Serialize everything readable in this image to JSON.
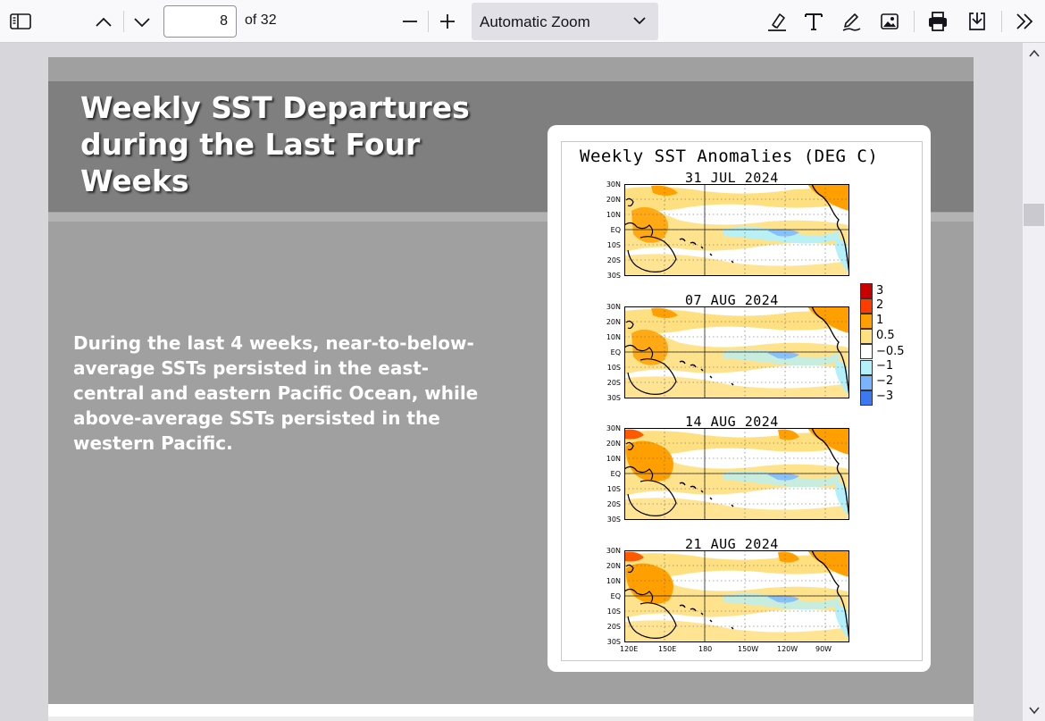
{
  "toolbar": {
    "page_number": "8",
    "page_count_label": "of 32",
    "zoom_label": "Automatic Zoom"
  },
  "slide": {
    "title": "Weekly SST Departures during the Last Four Weeks",
    "body": "During the last 4 weeks, near-to-below-average SSTs  persisted in the east-central and eastern Pacific Ocean, while above-average SSTs persisted in the western Pacific."
  },
  "figure": {
    "title": "Weekly SST Anomalies (DEG C)",
    "panels": [
      {
        "date": "31 JUL 2024"
      },
      {
        "date": "07 AUG 2024"
      },
      {
        "date": "14 AUG 2024"
      },
      {
        "date": "21 AUG 2024"
      }
    ],
    "lat_labels": [
      "30N",
      "20N",
      "10N",
      "EQ",
      "10S",
      "20S",
      "30S"
    ],
    "lon_labels": [
      "120E",
      "150E",
      "180",
      "150W",
      "120W",
      "90W"
    ],
    "legend": {
      "labels": [
        "3",
        "2",
        "1",
        "0.5",
        "−0.5",
        "−1",
        "−2",
        "−3"
      ],
      "colors": [
        "#c80000",
        "#ff3c00",
        "#ffa000",
        "#ffe080",
        "#ffffff",
        "#b4f0fa",
        "#78b4ff",
        "#3c78f0"
      ]
    },
    "anomaly_colors": {
      "warm_light": "#ffe080",
      "warm": "#ffa000",
      "warm_strong": "#ff5a00",
      "cool_light": "#b4f0fa",
      "cool": "#78b4ff"
    }
  }
}
